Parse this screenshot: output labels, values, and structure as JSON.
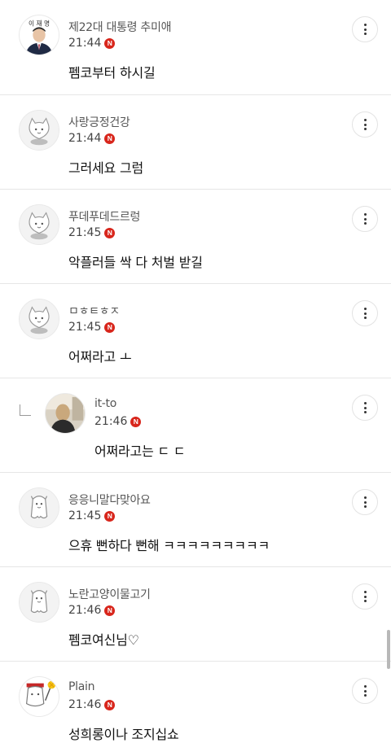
{
  "comments": [
    {
      "nickname": "제22대 대통령 추미애",
      "time": "21:44",
      "badge": "N",
      "text": "펨코부터 하시길",
      "avatar": "photo-portrait",
      "avatar_label": "이 재 명"
    },
    {
      "nickname": "사랑긍정건강",
      "time": "21:44",
      "badge": "N",
      "text": "그러세요 그럼",
      "avatar": "default-cat"
    },
    {
      "nickname": "푸데푸데드르렁",
      "time": "21:45",
      "badge": "N",
      "text": "악플러들 싹 다 처벌 받길",
      "avatar": "default-cat"
    },
    {
      "nickname": "ㅁㅎㅌㅎㅈ",
      "time": "21:45",
      "badge": "N",
      "text": "어쩌라고 ㅗ",
      "avatar": "default-cat"
    },
    {
      "nickname": "it-to",
      "time": "21:46",
      "badge": "N",
      "text": "어쩌라고는 ㄷ ㄷ",
      "avatar": "photo-person",
      "is_reply": true
    },
    {
      "nickname": "응응니말다맞아요",
      "time": "21:45",
      "badge": "N",
      "text": "으휴 뻔하다 뻔해 ㅋㅋㅋㅋㅋㅋㅋㅋㅋ",
      "avatar": "default-ghost"
    },
    {
      "nickname": "노란고양이물고기",
      "time": "21:46",
      "badge": "N",
      "text": "펨코여신님♡",
      "avatar": "default-ghost"
    },
    {
      "nickname": "Plain",
      "time": "21:46",
      "badge": "N",
      "text": "성희롱이나 조지십쇼",
      "avatar": "custom-cat-cheer"
    }
  ],
  "icons": {
    "more": "more-vertical-icon",
    "reply": "reply-arrow-icon"
  },
  "colors": {
    "badge": "#d8261c",
    "divider": "#e6e6e6"
  }
}
